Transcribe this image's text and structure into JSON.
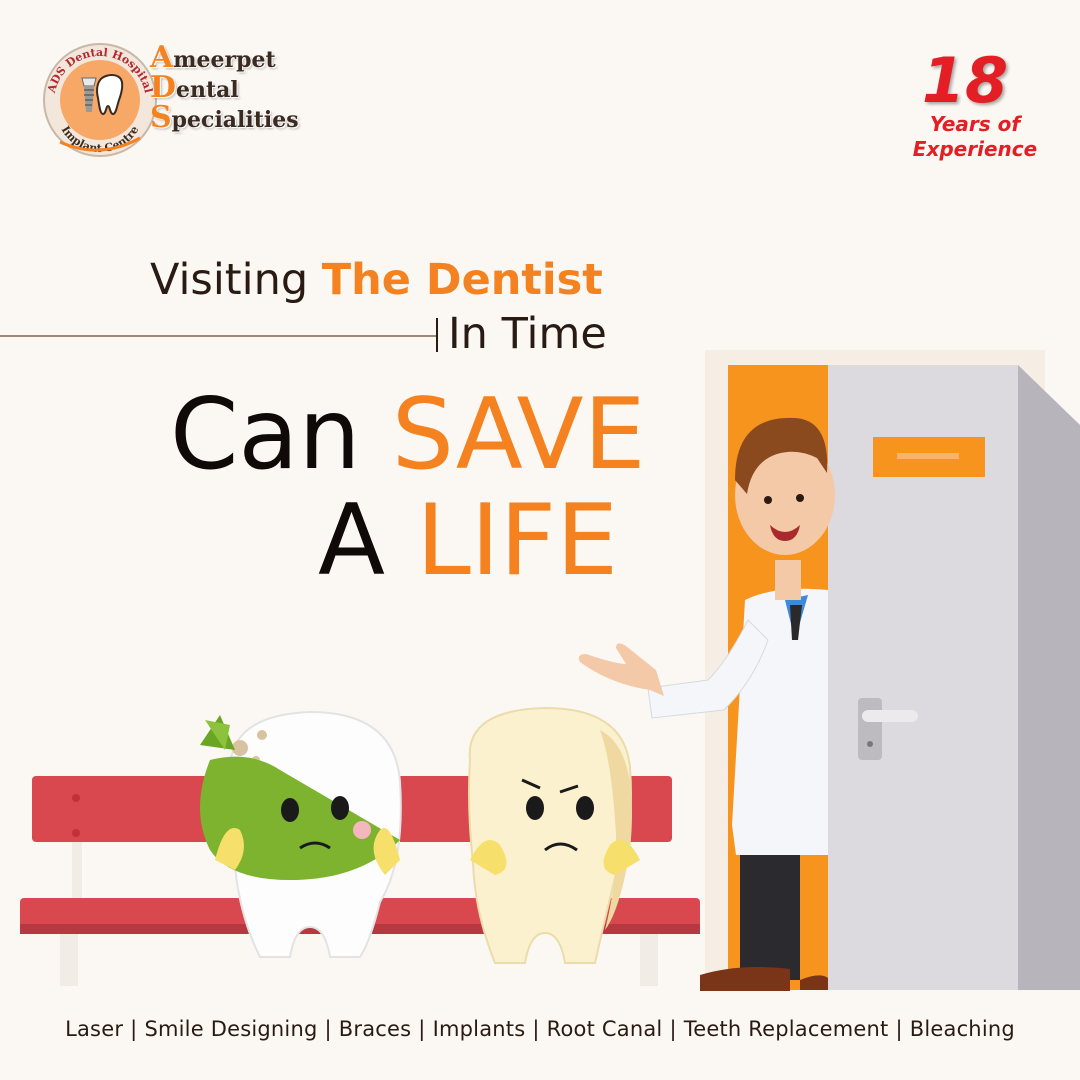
{
  "logo": {
    "ring_top": "ADS Dental Hospital",
    "ring_bottom": "Implant Centre",
    "words": [
      {
        "cap": "A",
        "rest": "meerpet"
      },
      {
        "cap": "D",
        "rest": "ental"
      },
      {
        "cap": "S",
        "rest": "pecialities"
      }
    ]
  },
  "experience": {
    "number": "18",
    "line1": "Years of",
    "line2": "Experience"
  },
  "headline": {
    "line1_plain": "Visiting ",
    "line1_highlight": "The Dentist",
    "line2": "In Time",
    "big1_plain": "Can ",
    "big1_highlight": "SAVE",
    "big2_plain": "A ",
    "big2_highlight": "LIFE"
  },
  "services": [
    "Laser",
    "Smile Designing",
    "Braces",
    "Implants",
    "Root Canal",
    "Teeth Replacement",
    "Bleaching"
  ],
  "colors": {
    "accent": "#f58220",
    "red": "#e31e24",
    "text": "#2a1a14",
    "background": "#fbf8f3",
    "bench": "#d9474f"
  }
}
